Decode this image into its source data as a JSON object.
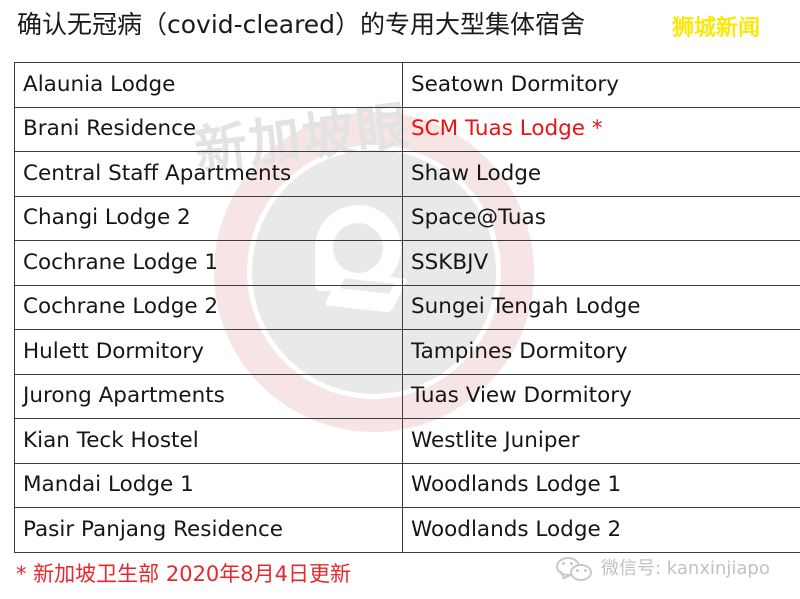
{
  "header": {
    "title": "确认无冠病（covid-cleared）的专用大型集体宿舍",
    "brand_logo": "狮城新闻",
    "brand_logo_color": "#fbe80b"
  },
  "watermark": {
    "text": "新加坡眼",
    "text_color": "#e3e3e3",
    "ring_color": "#f6dfe0",
    "circle_color": "#e9e9e9"
  },
  "table": {
    "highlight_color": "#ee1111",
    "border_color": "#3c3c3c",
    "rows": [
      {
        "left": "Alaunia Lodge",
        "right": "Seatown Dormitory",
        "left_highlight": false,
        "right_highlight": false
      },
      {
        "left": "Brani Residence",
        "right": "SCM Tuas Lodge *",
        "left_highlight": false,
        "right_highlight": true
      },
      {
        "left": "Central Staff Apartments",
        "right": "Shaw Lodge",
        "left_highlight": false,
        "right_highlight": false
      },
      {
        "left": "Changi Lodge 2",
        "right": "Space@Tuas",
        "left_highlight": false,
        "right_highlight": false
      },
      {
        "left": "Cochrane Lodge 1",
        "right": "SSKBJV",
        "left_highlight": false,
        "right_highlight": false
      },
      {
        "left": "Cochrane Lodge 2",
        "right": "Sungei Tengah Lodge",
        "left_highlight": false,
        "right_highlight": false
      },
      {
        "left": "Hulett Dormitory",
        "right": "Tampines Dormitory",
        "left_highlight": false,
        "right_highlight": false
      },
      {
        "left": "Jurong Apartments",
        "right": "Tuas View Dormitory",
        "left_highlight": false,
        "right_highlight": false
      },
      {
        "left": "Kian Teck Hostel",
        "right": "Westlite Juniper",
        "left_highlight": false,
        "right_highlight": false
      },
      {
        "left": "Mandai Lodge 1",
        "right": "Woodlands Lodge 1",
        "left_highlight": false,
        "right_highlight": false
      },
      {
        "left": "Pasir Panjang Residence",
        "right": "Woodlands Lodge 2",
        "left_highlight": false,
        "right_highlight": false
      }
    ]
  },
  "footer": {
    "footnote": "* 新加坡卫生部 2020年8月4日更新",
    "footnote_color": "#e8272b",
    "wechat_label": "微信号: kanxinjiapo",
    "wechat_icon": "wechat-icon"
  }
}
